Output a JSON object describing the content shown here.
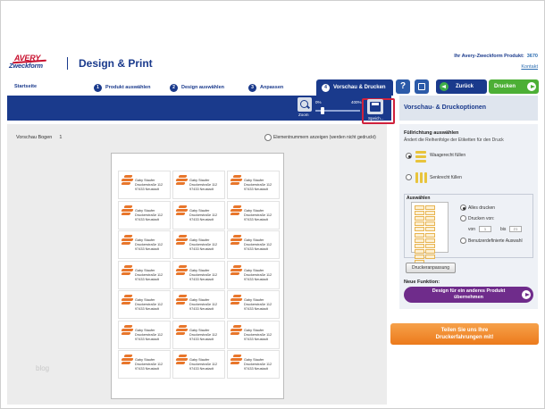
{
  "header": {
    "logo_line1": "AVERY",
    "logo_line2": "Zweckform",
    "app_title": "Design & Print",
    "product_label": "Ihr Avery-Zweckform Produkt:",
    "product_number": "3670",
    "contact_link": "Kontakt"
  },
  "nav": {
    "home": "Startseite",
    "steps": [
      {
        "num": "1",
        "label": "Produkt auswählen"
      },
      {
        "num": "2",
        "label": "Design auswählen"
      },
      {
        "num": "3",
        "label": "Anpassen"
      }
    ],
    "active_step": {
      "num": "4",
      "label": "Vorschau & Drucken"
    },
    "help_label": "?",
    "back_label": "Zurück",
    "print_label": "Drucken"
  },
  "toolbar": {
    "zoom_label": "Zoom",
    "zoom_min": "0%",
    "zoom_max": "400%",
    "zoom_level_fraction": 0.15,
    "save_label": "Speich..."
  },
  "preview": {
    "sheet_label": "Vorschau Bogen",
    "sheet_number": "1",
    "element_numbers_label": "Elementnummern anzeigen (werden nicht gedruckt)",
    "watermark": "blog",
    "label_lines": [
      "Gaby Staufer",
      "Druckerstraße 112",
      "97433 Neustadt"
    ],
    "rows": 7,
    "cols": 3
  },
  "options": {
    "panel_title": "Vorschau- & Druckoptionen",
    "fill_direction_title": "Füllrichtung auswählen",
    "fill_direction_desc": "Ändert die Reihenfolge der Etiketten für den Druck",
    "horizontal_label": "Waagerecht füllen",
    "vertical_label": "Senkrecht füllen",
    "select_title": "Auswählen",
    "print_all_label": "Alles drucken",
    "print_from_label": "Drucken von:",
    "from_label": "von",
    "from_value": "1",
    "to_label": "bis",
    "to_value": "21",
    "custom_label": "Benutzerdefinierte Auswahl",
    "print_adjust_label": "Druckeranpassung",
    "new_function_title": "Neue Funktion:",
    "design_other_line1": "Design für ein anderes Produkt",
    "design_other_line2": "übernehmen",
    "feedback_line1": "Teilen Sie uns Ihre",
    "feedback_line2": "Druckerfahrungen mit!"
  },
  "colors": {
    "brand_blue": "#1a3a8c",
    "print_green": "#4caf35",
    "purple": "#6f2c8b",
    "orange": "#ec7a1b",
    "highlight_red": "#d0213b"
  }
}
